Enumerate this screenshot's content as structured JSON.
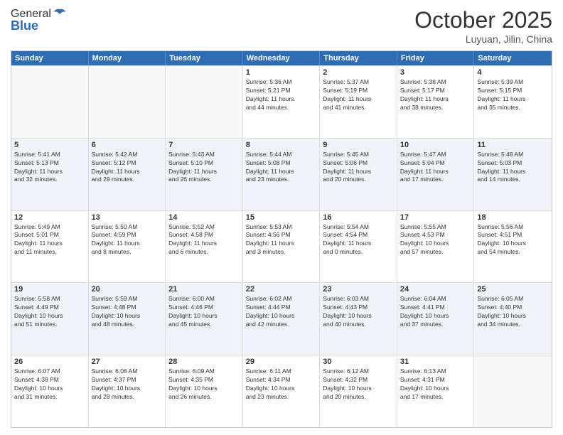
{
  "header": {
    "logo_line1": "General",
    "logo_line2": "Blue",
    "month": "October 2025",
    "location": "Luyuan, Jilin, China"
  },
  "weekdays": [
    "Sunday",
    "Monday",
    "Tuesday",
    "Wednesday",
    "Thursday",
    "Friday",
    "Saturday"
  ],
  "rows": [
    [
      {
        "day": "",
        "info": ""
      },
      {
        "day": "",
        "info": ""
      },
      {
        "day": "",
        "info": ""
      },
      {
        "day": "1",
        "info": "Sunrise: 5:36 AM\nSunset: 5:21 PM\nDaylight: 11 hours\nand 44 minutes."
      },
      {
        "day": "2",
        "info": "Sunrise: 5:37 AM\nSunset: 5:19 PM\nDaylight: 11 hours\nand 41 minutes."
      },
      {
        "day": "3",
        "info": "Sunrise: 5:38 AM\nSunset: 5:17 PM\nDaylight: 11 hours\nand 38 minutes."
      },
      {
        "day": "4",
        "info": "Sunrise: 5:39 AM\nSunset: 5:15 PM\nDaylight: 11 hours\nand 35 minutes."
      }
    ],
    [
      {
        "day": "5",
        "info": "Sunrise: 5:41 AM\nSunset: 5:13 PM\nDaylight: 11 hours\nand 32 minutes."
      },
      {
        "day": "6",
        "info": "Sunrise: 5:42 AM\nSunset: 5:12 PM\nDaylight: 11 hours\nand 29 minutes."
      },
      {
        "day": "7",
        "info": "Sunrise: 5:43 AM\nSunset: 5:10 PM\nDaylight: 11 hours\nand 26 minutes."
      },
      {
        "day": "8",
        "info": "Sunrise: 5:44 AM\nSunset: 5:08 PM\nDaylight: 11 hours\nand 23 minutes."
      },
      {
        "day": "9",
        "info": "Sunrise: 5:45 AM\nSunset: 5:06 PM\nDaylight: 11 hours\nand 20 minutes."
      },
      {
        "day": "10",
        "info": "Sunrise: 5:47 AM\nSunset: 5:04 PM\nDaylight: 11 hours\nand 17 minutes."
      },
      {
        "day": "11",
        "info": "Sunrise: 5:48 AM\nSunset: 5:03 PM\nDaylight: 11 hours\nand 14 minutes."
      }
    ],
    [
      {
        "day": "12",
        "info": "Sunrise: 5:49 AM\nSunset: 5:01 PM\nDaylight: 11 hours\nand 11 minutes."
      },
      {
        "day": "13",
        "info": "Sunrise: 5:50 AM\nSunset: 4:59 PM\nDaylight: 11 hours\nand 8 minutes."
      },
      {
        "day": "14",
        "info": "Sunrise: 5:52 AM\nSunset: 4:58 PM\nDaylight: 11 hours\nand 6 minutes."
      },
      {
        "day": "15",
        "info": "Sunrise: 5:53 AM\nSunset: 4:56 PM\nDaylight: 11 hours\nand 3 minutes."
      },
      {
        "day": "16",
        "info": "Sunrise: 5:54 AM\nSunset: 4:54 PM\nDaylight: 11 hours\nand 0 minutes."
      },
      {
        "day": "17",
        "info": "Sunrise: 5:55 AM\nSunset: 4:53 PM\nDaylight: 10 hours\nand 57 minutes."
      },
      {
        "day": "18",
        "info": "Sunrise: 5:56 AM\nSunset: 4:51 PM\nDaylight: 10 hours\nand 54 minutes."
      }
    ],
    [
      {
        "day": "19",
        "info": "Sunrise: 5:58 AM\nSunset: 4:49 PM\nDaylight: 10 hours\nand 51 minutes."
      },
      {
        "day": "20",
        "info": "Sunrise: 5:59 AM\nSunset: 4:48 PM\nDaylight: 10 hours\nand 48 minutes."
      },
      {
        "day": "21",
        "info": "Sunrise: 6:00 AM\nSunset: 4:46 PM\nDaylight: 10 hours\nand 45 minutes."
      },
      {
        "day": "22",
        "info": "Sunrise: 6:02 AM\nSunset: 4:44 PM\nDaylight: 10 hours\nand 42 minutes."
      },
      {
        "day": "23",
        "info": "Sunrise: 6:03 AM\nSunset: 4:43 PM\nDaylight: 10 hours\nand 40 minutes."
      },
      {
        "day": "24",
        "info": "Sunrise: 6:04 AM\nSunset: 4:41 PM\nDaylight: 10 hours\nand 37 minutes."
      },
      {
        "day": "25",
        "info": "Sunrise: 6:05 AM\nSunset: 4:40 PM\nDaylight: 10 hours\nand 34 minutes."
      }
    ],
    [
      {
        "day": "26",
        "info": "Sunrise: 6:07 AM\nSunset: 4:38 PM\nDaylight: 10 hours\nand 31 minutes."
      },
      {
        "day": "27",
        "info": "Sunrise: 6:08 AM\nSunset: 4:37 PM\nDaylight: 10 hours\nand 28 minutes."
      },
      {
        "day": "28",
        "info": "Sunrise: 6:09 AM\nSunset: 4:35 PM\nDaylight: 10 hours\nand 26 minutes."
      },
      {
        "day": "29",
        "info": "Sunrise: 6:11 AM\nSunset: 4:34 PM\nDaylight: 10 hours\nand 23 minutes."
      },
      {
        "day": "30",
        "info": "Sunrise: 6:12 AM\nSunset: 4:32 PM\nDaylight: 10 hours\nand 20 minutes."
      },
      {
        "day": "31",
        "info": "Sunrise: 6:13 AM\nSunset: 4:31 PM\nDaylight: 10 hours\nand 17 minutes."
      },
      {
        "day": "",
        "info": ""
      }
    ]
  ]
}
